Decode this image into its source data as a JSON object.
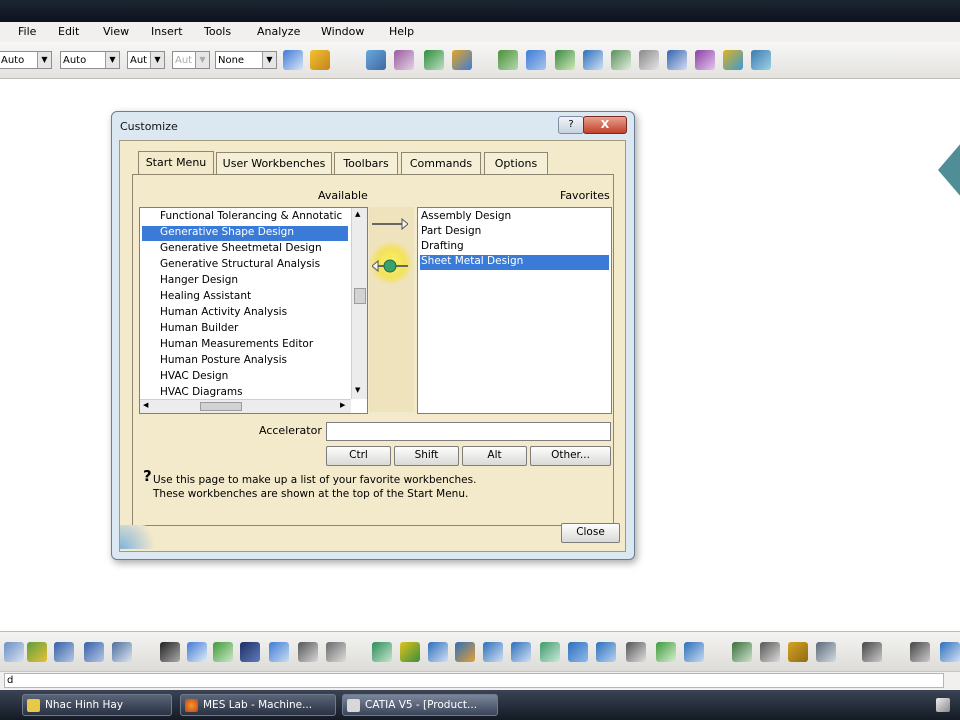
{
  "menubar": {
    "items": [
      "File",
      "Edit",
      "View",
      "Insert",
      "Tools",
      "Analyze",
      "Window",
      "Help"
    ]
  },
  "toolbar1": {
    "combos": [
      "Auto",
      "Auto",
      "Aut",
      "Aut",
      "None"
    ]
  },
  "dialog": {
    "title": "Customize",
    "help_button": "?",
    "close_x": "X",
    "tabs": [
      "Start Menu",
      "User Workbenches",
      "Toolbars",
      "Commands",
      "Options"
    ],
    "available_label": "Available",
    "favorites_label": "Favorites",
    "available_items": [
      "Functional Tolerancing & Annotatic",
      "Generative Shape Design",
      "Generative Sheetmetal Design",
      "Generative Structural Analysis",
      "Hanger Design",
      "Healing Assistant",
      "Human Activity Analysis",
      "Human Builder",
      "Human Measurements Editor",
      "Human Posture Analysis",
      "HVAC Design",
      "HVAC Diagrams"
    ],
    "available_selected": "Generative Shape Design",
    "favorite_items": [
      "Assembly Design",
      "Part Design",
      "Drafting",
      "Sheet Metal Design"
    ],
    "favorite_selected": "Sheet Metal Design",
    "accelerator_label": "Accelerator",
    "accelerator_value": "",
    "modifier_buttons": [
      "Ctrl",
      "Shift",
      "Alt",
      "Other..."
    ],
    "info_line1": "Use this page to make up a list of your favorite workbenches.",
    "info_line2": "These workbenches are shown at the top of the Start Menu.",
    "close_button": "Close"
  },
  "statusbar": {
    "command_value": "d"
  },
  "taskbar": {
    "items": [
      "Nhac Hinh Hay",
      "MES Lab - Machine...",
      "CATIA V5 - [Product..."
    ]
  },
  "colors": {
    "selection": "#3b7bd8",
    "dialog_body": "#f3e9cb",
    "taskbar": "#1c2533"
  }
}
